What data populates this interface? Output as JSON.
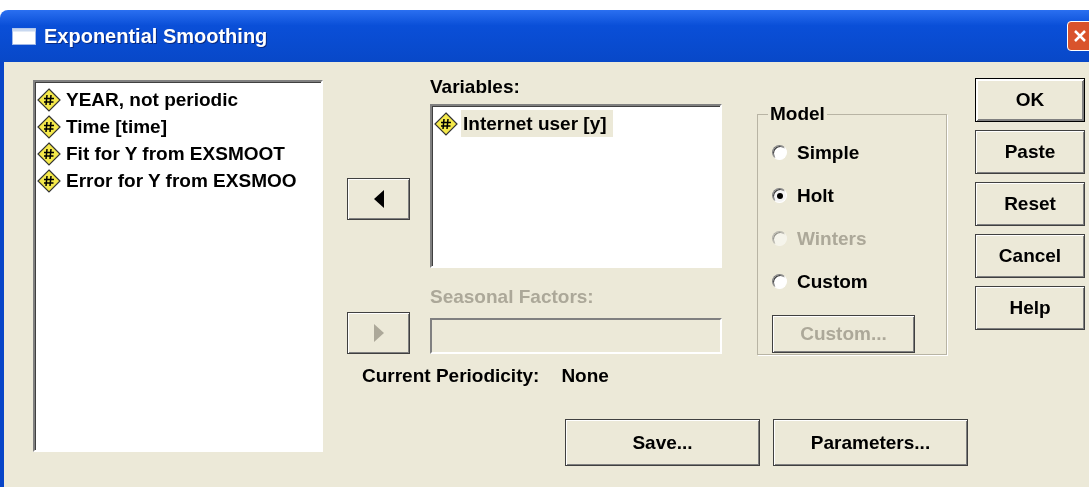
{
  "window": {
    "title": "Exponential Smoothing"
  },
  "source_list": {
    "items": [
      {
        "label": "YEAR, not periodic",
        "selected": false
      },
      {
        "label": "Time [time]",
        "selected": false
      },
      {
        "label": "Fit for Y from EXSMOOT",
        "selected": false
      },
      {
        "label": "Error for Y from EXSMOO",
        "selected": false
      }
    ]
  },
  "move_button": {
    "disabled": false
  },
  "variables": {
    "label": "Variables:",
    "items": [
      {
        "label": "Internet user [y]",
        "selected": true
      }
    ]
  },
  "seasonal": {
    "label": "Seasonal Factors:",
    "disabled": true
  },
  "periodicity": {
    "label": "Current Periodicity:",
    "value": "None"
  },
  "model": {
    "title": "Model",
    "options": [
      {
        "label": "Simple",
        "selected": false,
        "disabled": false
      },
      {
        "label": "Holt",
        "selected": true,
        "disabled": false
      },
      {
        "label": "Winters",
        "selected": false,
        "disabled": true
      },
      {
        "label": "Custom",
        "selected": false,
        "disabled": false
      }
    ],
    "custom_button": {
      "label": "Custom...",
      "disabled": true
    }
  },
  "buttons": [
    {
      "label": "OK",
      "default": true
    },
    {
      "label": "Paste",
      "default": false
    },
    {
      "label": "Reset",
      "default": false
    },
    {
      "label": "Cancel",
      "default": false
    },
    {
      "label": "Help",
      "default": false
    }
  ],
  "bottom_buttons": [
    "Save...",
    "Parameters..."
  ]
}
